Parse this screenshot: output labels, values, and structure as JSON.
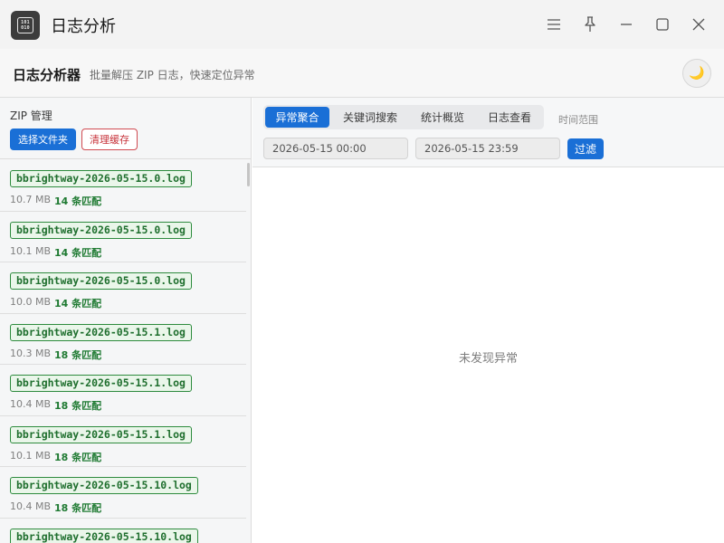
{
  "window": {
    "title": "日志分析",
    "app_icon_text": [
      "101",
      "010"
    ]
  },
  "header": {
    "title": "日志分析器",
    "subtitle": "批量解压 ZIP 日志，快速定位异常",
    "theme_icon": "🌙"
  },
  "zip": {
    "label": "ZIP 管理",
    "select_button": "选择文件夹",
    "clear_button": "清理缓存"
  },
  "files": [
    {
      "name": "bbrightway-2026-05-15.0.log",
      "size": "10.7 MB",
      "matches": "14 条匹配"
    },
    {
      "name": "bbrightway-2026-05-15.0.log",
      "size": "10.1 MB",
      "matches": "14 条匹配"
    },
    {
      "name": "bbrightway-2026-05-15.0.log",
      "size": "10.0 MB",
      "matches": "14 条匹配"
    },
    {
      "name": "bbrightway-2026-05-15.1.log",
      "size": "10.3 MB",
      "matches": "18 条匹配"
    },
    {
      "name": "bbrightway-2026-05-15.1.log",
      "size": "10.4 MB",
      "matches": "18 条匹配"
    },
    {
      "name": "bbrightway-2026-05-15.1.log",
      "size": "10.1 MB",
      "matches": "18 条匹配"
    },
    {
      "name": "bbrightway-2026-05-15.10.log",
      "size": "10.4 MB",
      "matches": "18 条匹配"
    },
    {
      "name": "bbrightway-2026-05-15.10.log",
      "size": "",
      "matches": ""
    }
  ],
  "tabs": [
    {
      "label": "异常聚合",
      "active": true
    },
    {
      "label": "关键词搜索",
      "active": false
    },
    {
      "label": "统计概览",
      "active": false
    },
    {
      "label": "日志查看",
      "active": false
    }
  ],
  "filter": {
    "range_label": "时间范围",
    "start": "2026-05-15 00:00",
    "end": "2026-05-15 23:59",
    "button": "过滤"
  },
  "main": {
    "empty_text": "未发现异常"
  },
  "colors": {
    "accent": "#1a6fd6",
    "danger": "#c7323a",
    "match_green": "#1f7a32"
  }
}
